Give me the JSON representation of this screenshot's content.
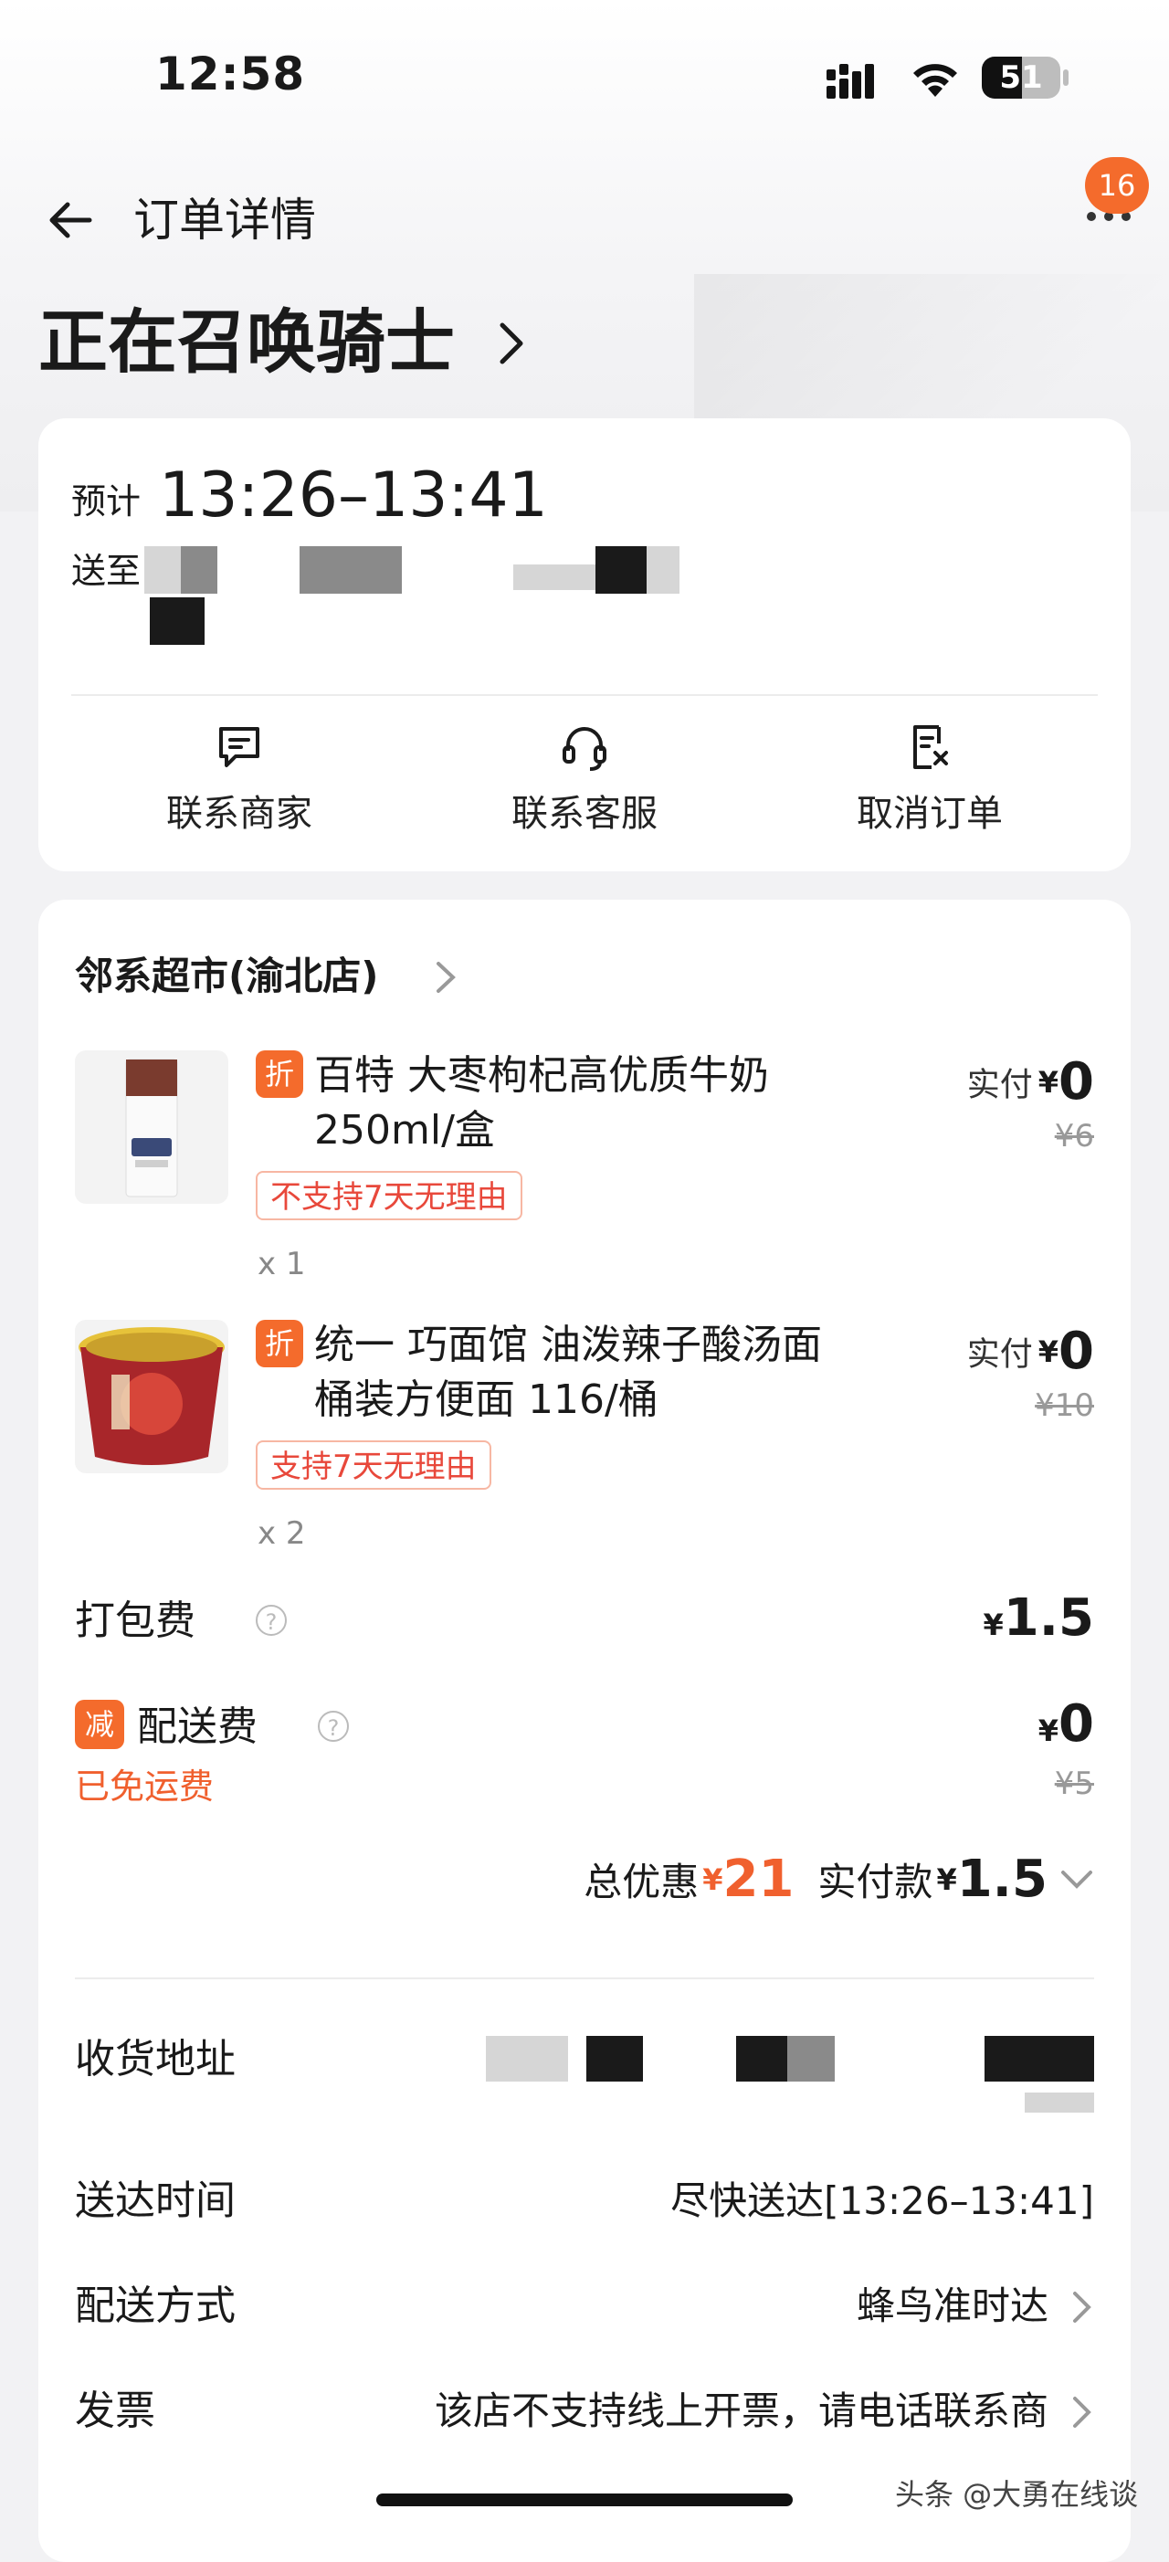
{
  "status_bar": {
    "time": "12:58",
    "battery": "51",
    "battery_level": 0.51
  },
  "nav": {
    "title": "订单详情",
    "badge": "16"
  },
  "status": {
    "headline": "正在召唤骑士"
  },
  "delivery": {
    "eta_label": "预计",
    "eta_time": "13:26–13:41",
    "address_label": "送至"
  },
  "actions": [
    {
      "label": "联系商家",
      "icon": "message-icon"
    },
    {
      "label": "联系客服",
      "icon": "headset-icon"
    },
    {
      "label": "取消订单",
      "icon": "cancel-order-icon"
    }
  ],
  "store": {
    "name": "邻系超市(渝北店)"
  },
  "items": [
    {
      "tag": "折",
      "name": "百特 大枣枸杞高优质牛奶 250ml/盒",
      "return_policy": "不支持7天无理由",
      "qty": "x 1",
      "paid_label": "实付",
      "currency": "¥",
      "paid": "0",
      "original": "¥6"
    },
    {
      "tag": "折",
      "name": "统一 巧面馆 油泼辣子酸汤面桶装方便面 116/桶",
      "return_policy": "支持7天无理由",
      "qty": "x 2",
      "paid_label": "实付",
      "currency": "¥",
      "paid": "0",
      "original": "¥10"
    }
  ],
  "fees": {
    "packing_label": "打包费",
    "packing_currency": "¥",
    "packing_value": "1.5",
    "delivery_tag": "减",
    "delivery_label": "配送费",
    "delivery_currency": "¥",
    "delivery_value": "0",
    "delivery_original": "¥5",
    "delivery_note": "已免运费"
  },
  "summary": {
    "discount_label": "总优惠",
    "discount_currency": "¥",
    "discount_value": "21",
    "paid_label": "实付款",
    "paid_currency": "¥",
    "paid_value": "1.5"
  },
  "info": {
    "address_label": "收货地址",
    "time_label": "送达时间",
    "time_value": "尽快送达[13:26–13:41]",
    "method_label": "配送方式",
    "method_value": "蜂鸟准时达",
    "invoice_label": "发票",
    "invoice_value": "该店不支持线上开票，请电话联系商"
  },
  "watermark": "头条 @大勇在线谈",
  "colors": {
    "accent": "#f46b2c",
    "discount_red": "#f0602e",
    "return_red": "#e8483b"
  }
}
